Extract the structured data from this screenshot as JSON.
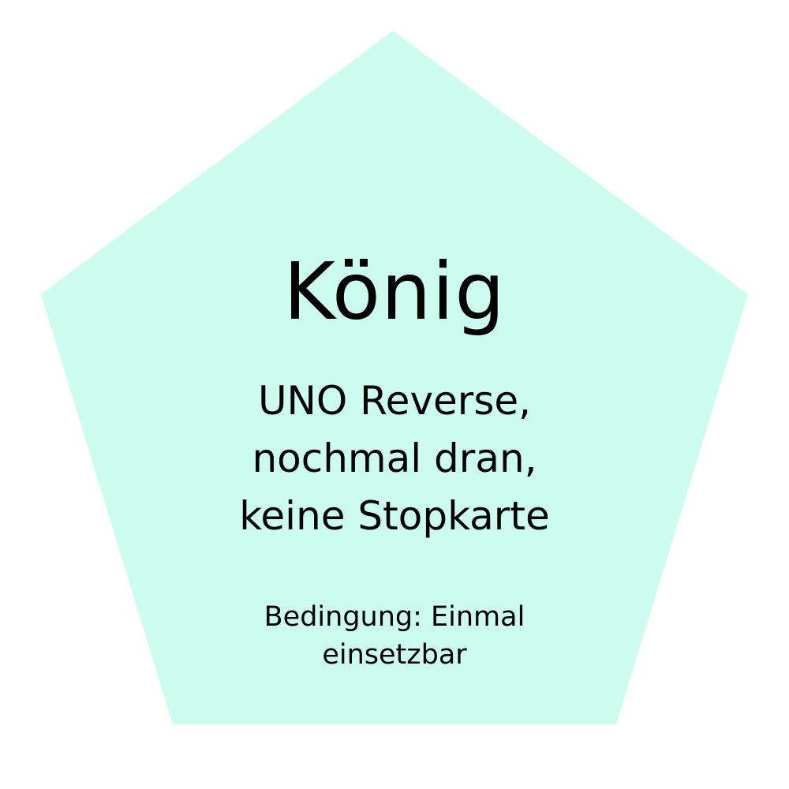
{
  "card": {
    "fill_color": "#ccfcef",
    "title": "König",
    "description": [
      "UNO Reverse,",
      "nochmal dran,",
      "keine Stopkarte"
    ],
    "condition": [
      "Bedingung: Einmal",
      "einsetzbar"
    ]
  }
}
